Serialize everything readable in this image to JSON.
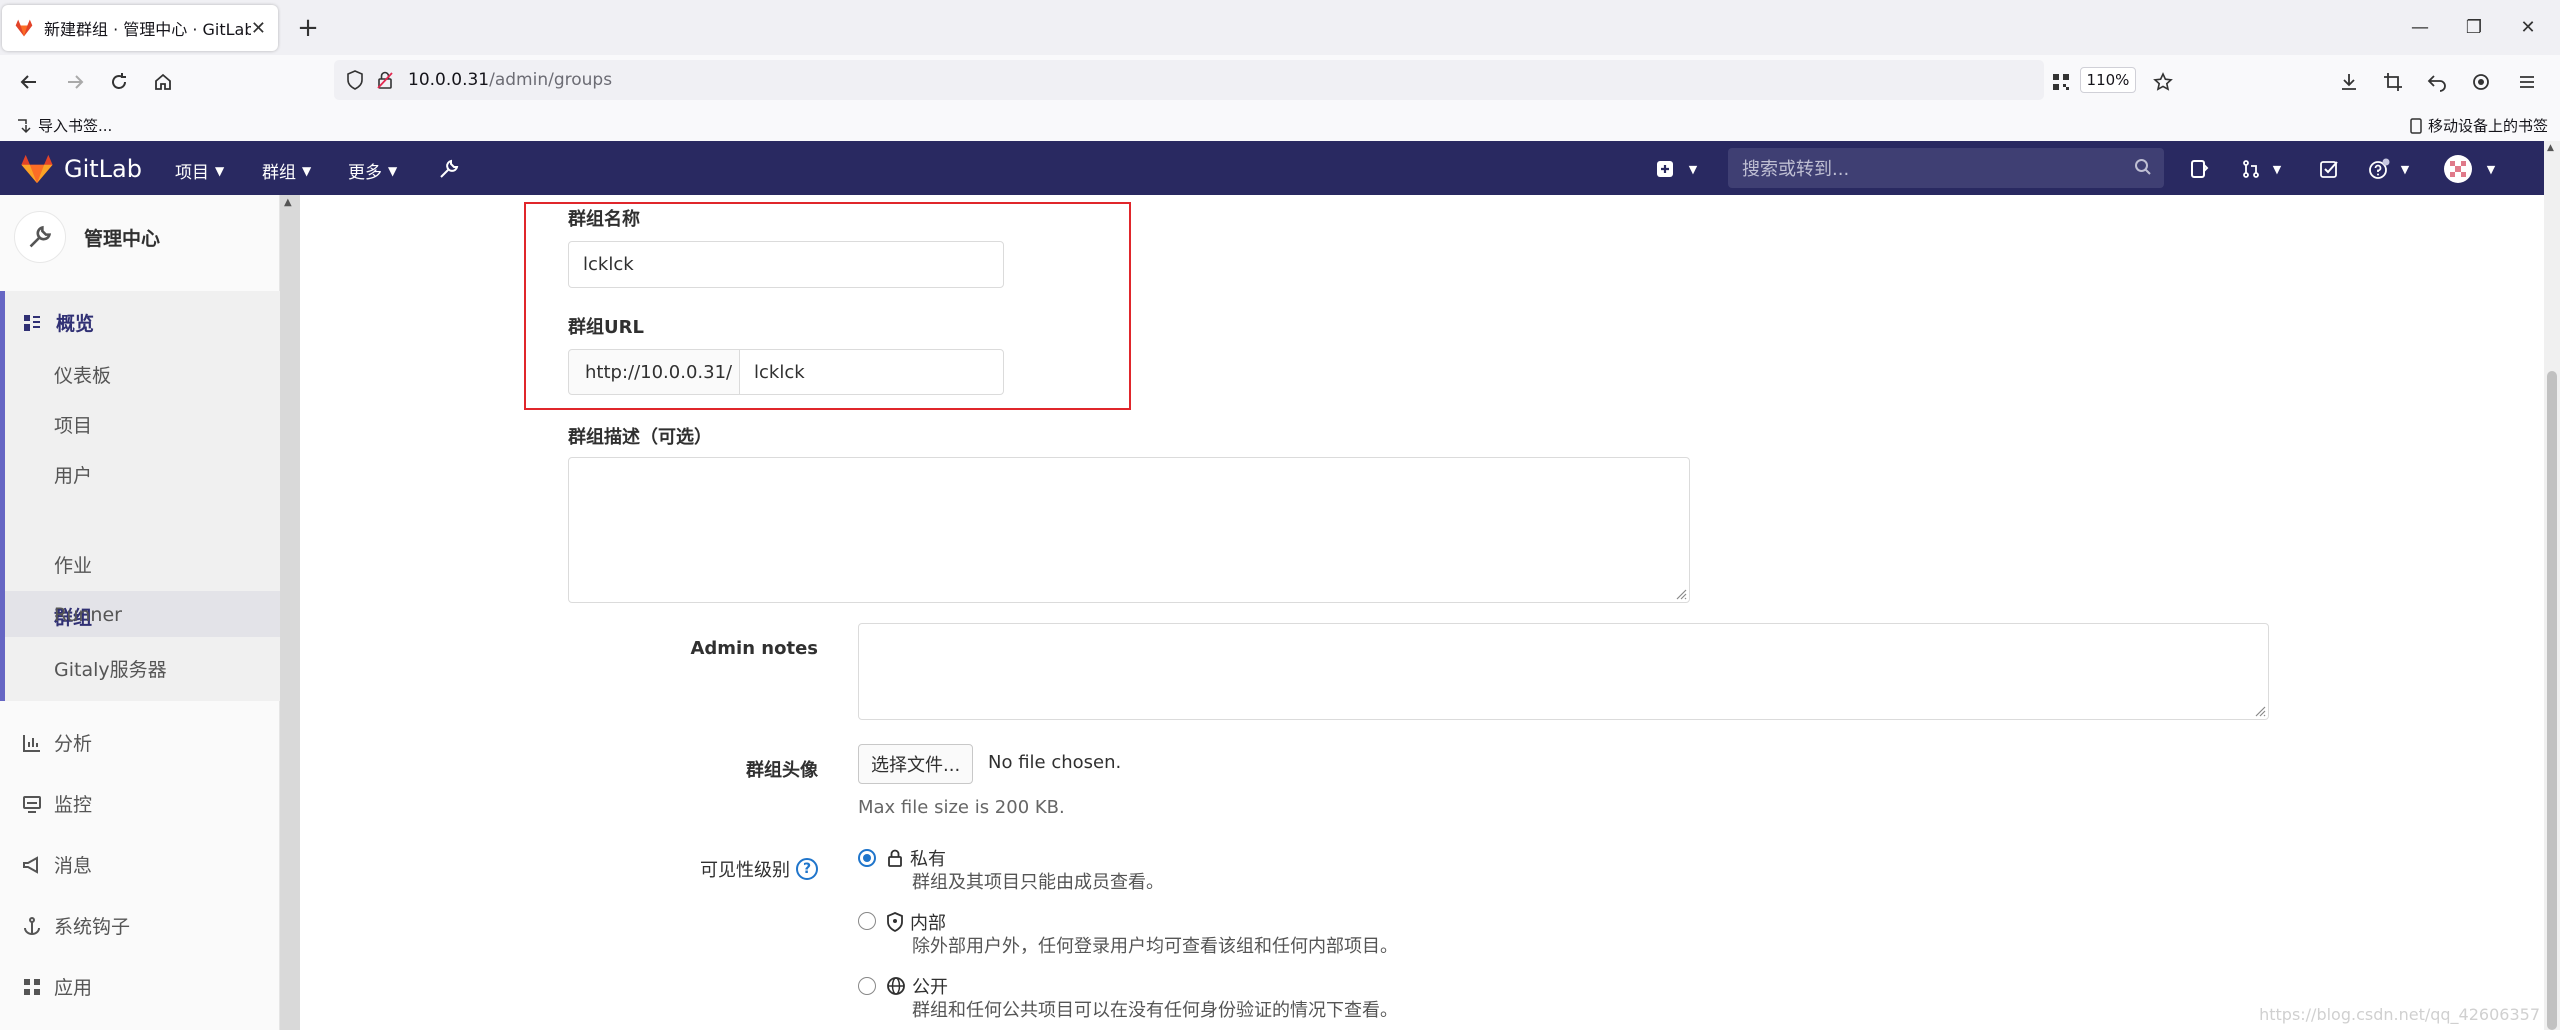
{
  "browser": {
    "tab_title": "新建群组 · 管理中心 · GitLab",
    "url_host": "10.0.0.31",
    "url_path": "/admin/groups",
    "zoom": "110%",
    "bookmark_import": "导入书签...",
    "bookmark_mobile": "移动设备上的书签"
  },
  "gitlab_header": {
    "brand": "GitLab",
    "menu_projects": "项目",
    "menu_groups": "群组",
    "menu_more": "更多",
    "search_placeholder": "搜索或转到..."
  },
  "sidebar": {
    "title": "管理中心",
    "overview": "概览",
    "sub_items": [
      "仪表板",
      "项目",
      "用户",
      "群组",
      "作业",
      "Runner",
      "Gitaly服务器"
    ],
    "active_sub": "群组",
    "items": [
      "分析",
      "监控",
      "消息",
      "系统钩子",
      "应用"
    ]
  },
  "form": {
    "group_name_label": "群组名称",
    "group_name_value": "lcklck",
    "group_url_label": "群组URL",
    "group_url_prefix": "http://10.0.0.31/",
    "group_url_value": "lcklck",
    "description_label": "群组描述（可选）",
    "admin_notes_label": "Admin notes",
    "avatar_label": "群组头像",
    "choose_file_button": "选择文件...",
    "no_file": "No file chosen.",
    "max_size": "Max file size is 200 KB.",
    "visibility_label": "可见性级别",
    "visibility_options": [
      {
        "title": "私有",
        "desc": "群组及其项目只能由成员查看。",
        "checked": true
      },
      {
        "title": "内部",
        "desc": "除外部用户外，任何登录用户均可查看该组和任何内部项目。",
        "checked": false
      },
      {
        "title": "公开",
        "desc": "群组和任何公共项目可以在没有任何身份验证的情况下查看。",
        "checked": false
      }
    ]
  },
  "watermark": "https://blog.csdn.net/qq_42606357",
  "colors": {
    "gitlab_header": "#292961",
    "highlight_box": "#e0262b",
    "radio_accent": "#1f75cb"
  }
}
